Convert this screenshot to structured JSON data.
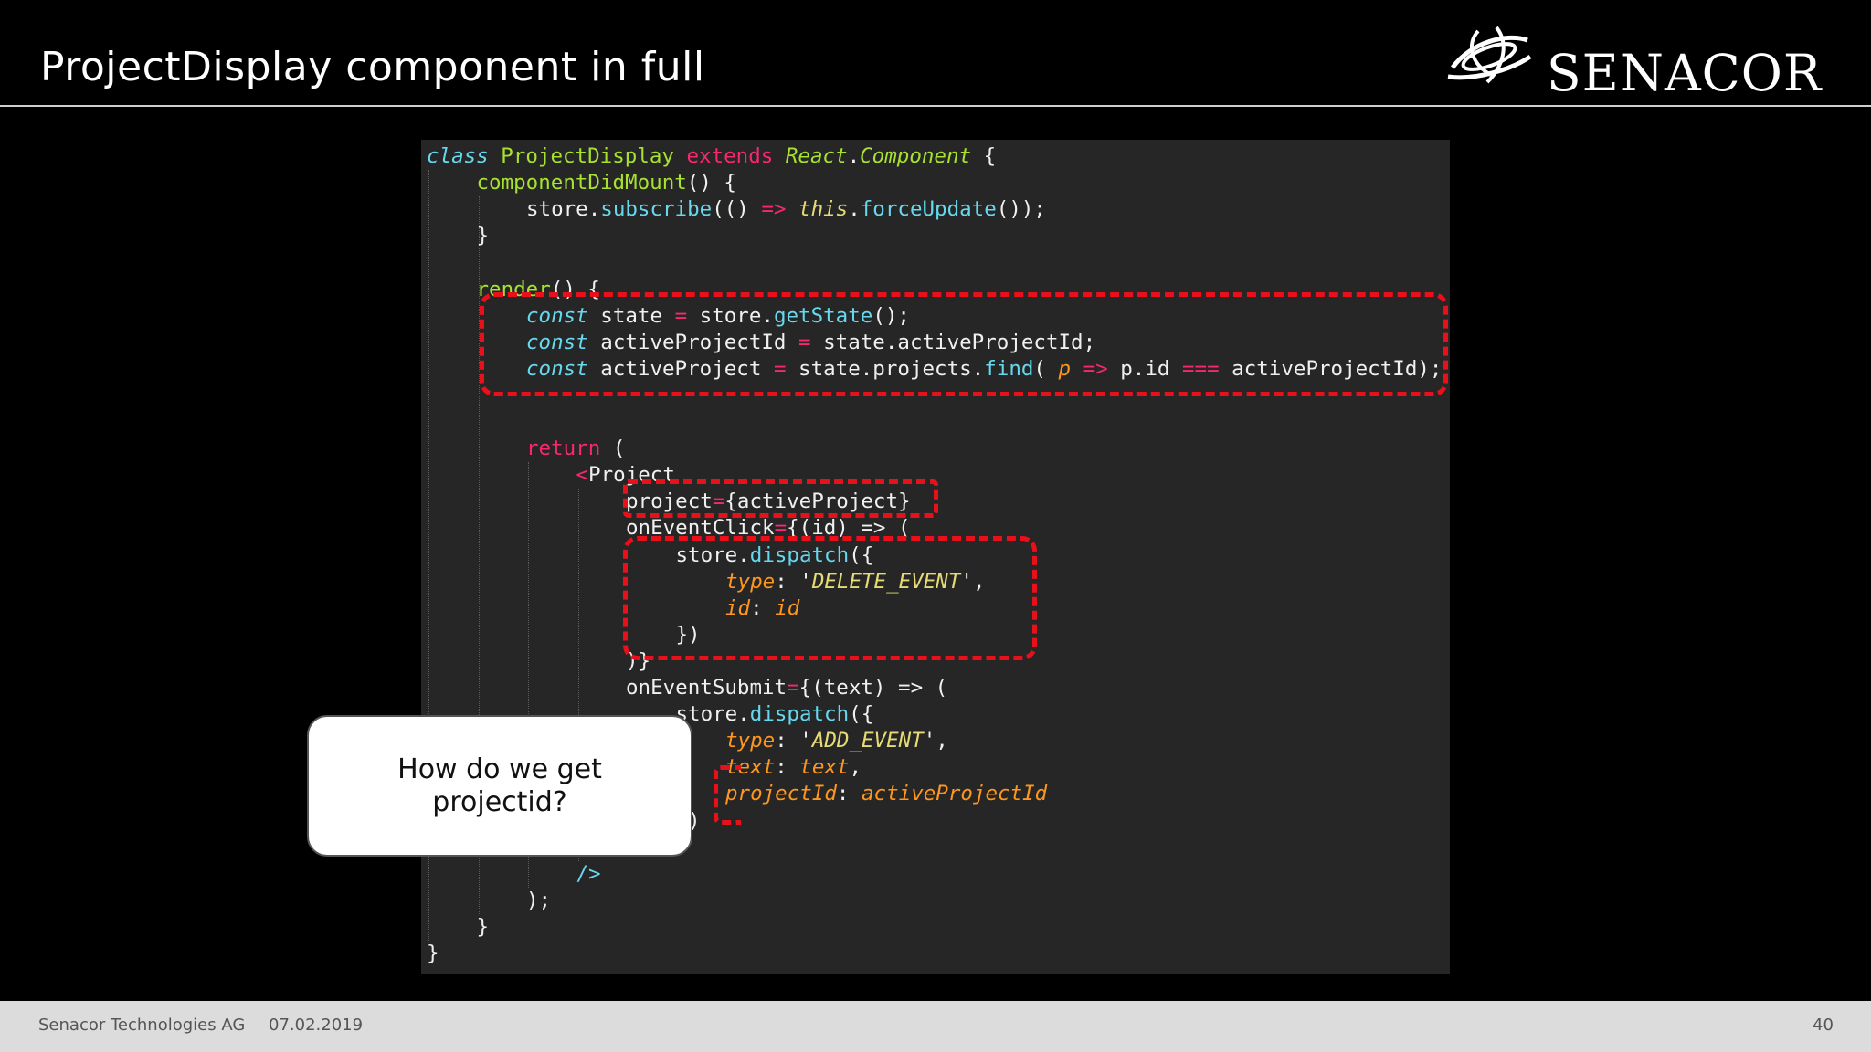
{
  "slide": {
    "title": "ProjectDisplay component in full",
    "logo_text": "SENACOR",
    "logo_icon": "senacor-swirl-logo"
  },
  "code_lines": [
    {
      "indent": 0,
      "tokens": [
        {
          "c": "kw-italic",
          "t": "class "
        },
        {
          "c": "cls",
          "t": "ProjectDisplay "
        },
        {
          "c": "kw-pink",
          "t": "extends "
        },
        {
          "c": "cls-it",
          "t": "React"
        },
        {
          "c": "plain",
          "t": "."
        },
        {
          "c": "cls-it",
          "t": "Component"
        },
        {
          "c": "plain",
          "t": " {"
        }
      ]
    },
    {
      "indent": 1,
      "tokens": [
        {
          "c": "meth",
          "t": "componentDidMount"
        },
        {
          "c": "plain",
          "t": "() {"
        }
      ]
    },
    {
      "indent": 2,
      "tokens": [
        {
          "c": "plain",
          "t": "store."
        },
        {
          "c": "fn",
          "t": "subscribe"
        },
        {
          "c": "plain",
          "t": "(() "
        },
        {
          "c": "kw-pink",
          "t": "=>"
        },
        {
          "c": "plain",
          "t": " "
        },
        {
          "c": "str",
          "t": "this"
        },
        {
          "c": "plain",
          "t": "."
        },
        {
          "c": "fn",
          "t": "forceUpdate"
        },
        {
          "c": "plain",
          "t": "());"
        }
      ]
    },
    {
      "indent": 1,
      "tokens": [
        {
          "c": "plain",
          "t": "}"
        }
      ]
    },
    {
      "indent": 1,
      "tokens": []
    },
    {
      "indent": 1,
      "tokens": [
        {
          "c": "meth",
          "t": "render"
        },
        {
          "c": "plain",
          "t": "() {"
        }
      ]
    },
    {
      "indent": 2,
      "tokens": [
        {
          "c": "kw-italic",
          "t": "const"
        },
        {
          "c": "plain",
          "t": " state "
        },
        {
          "c": "kw-pink",
          "t": "="
        },
        {
          "c": "plain",
          "t": " store."
        },
        {
          "c": "fn",
          "t": "getState"
        },
        {
          "c": "plain",
          "t": "();"
        }
      ]
    },
    {
      "indent": 2,
      "tokens": [
        {
          "c": "kw-italic",
          "t": "const"
        },
        {
          "c": "plain",
          "t": " activeProjectId "
        },
        {
          "c": "kw-pink",
          "t": "="
        },
        {
          "c": "plain",
          "t": " state.activeProjectId;"
        }
      ]
    },
    {
      "indent": 2,
      "tokens": [
        {
          "c": "kw-italic",
          "t": "const"
        },
        {
          "c": "plain",
          "t": " activeProject "
        },
        {
          "c": "kw-pink",
          "t": "="
        },
        {
          "c": "plain",
          "t": " state.projects."
        },
        {
          "c": "fn",
          "t": "find"
        },
        {
          "c": "plain",
          "t": "( "
        },
        {
          "c": "prop",
          "t": "p"
        },
        {
          "c": "plain",
          "t": " "
        },
        {
          "c": "kw-pink",
          "t": "=>"
        },
        {
          "c": "plain",
          "t": " p.id "
        },
        {
          "c": "kw-pink",
          "t": "==="
        },
        {
          "c": "plain",
          "t": " activeProjectId);"
        }
      ]
    },
    {
      "indent": 2,
      "tokens": []
    },
    {
      "indent": 2,
      "tokens": []
    },
    {
      "indent": 2,
      "tokens": [
        {
          "c": "kw-pink",
          "t": "return"
        },
        {
          "c": "plain",
          "t": " ("
        }
      ]
    },
    {
      "indent": 3,
      "tokens": [
        {
          "c": "kw-pink",
          "t": "<"
        },
        {
          "c": "plain",
          "t": "Project"
        }
      ]
    },
    {
      "indent": 4,
      "tokens": [
        {
          "c": "plain",
          "t": "project"
        },
        {
          "c": "kw-pink",
          "t": "="
        },
        {
          "c": "plain",
          "t": "{activeProject}"
        }
      ]
    },
    {
      "indent": 4,
      "tokens": [
        {
          "c": "plain",
          "t": "onEventClick"
        },
        {
          "c": "kw-pink",
          "t": "="
        },
        {
          "c": "plain",
          "t": "{(id) => ("
        }
      ]
    },
    {
      "indent": 5,
      "tokens": [
        {
          "c": "plain",
          "t": "store."
        },
        {
          "c": "fn",
          "t": "dispatch"
        },
        {
          "c": "plain",
          "t": "({"
        }
      ]
    },
    {
      "indent": 6,
      "tokens": [
        {
          "c": "prop",
          "t": "type"
        },
        {
          "c": "plain",
          "t": ": '"
        },
        {
          "c": "str",
          "t": "DELETE_EVENT"
        },
        {
          "c": "plain",
          "t": "',"
        }
      ]
    },
    {
      "indent": 6,
      "tokens": [
        {
          "c": "prop",
          "t": "id"
        },
        {
          "c": "plain",
          "t": ": "
        },
        {
          "c": "prop",
          "t": "id"
        }
      ]
    },
    {
      "indent": 5,
      "tokens": [
        {
          "c": "plain",
          "t": "})"
        }
      ]
    },
    {
      "indent": 4,
      "tokens": [
        {
          "c": "plain",
          "t": ")}"
        }
      ]
    },
    {
      "indent": 4,
      "tokens": [
        {
          "c": "plain",
          "t": "onEventSubmit"
        },
        {
          "c": "kw-pink",
          "t": "="
        },
        {
          "c": "plain",
          "t": "{(text) => ("
        }
      ]
    },
    {
      "indent": 5,
      "tokens": [
        {
          "c": "plain",
          "t": "store."
        },
        {
          "c": "fn",
          "t": "dispatch"
        },
        {
          "c": "plain",
          "t": "({"
        }
      ]
    },
    {
      "indent": 6,
      "tokens": [
        {
          "c": "prop",
          "t": "type"
        },
        {
          "c": "plain",
          "t": ": '"
        },
        {
          "c": "str",
          "t": "ADD_EVENT"
        },
        {
          "c": "plain",
          "t": "',"
        }
      ]
    },
    {
      "indent": 6,
      "tokens": [
        {
          "c": "prop",
          "t": "text"
        },
        {
          "c": "plain",
          "t": ": "
        },
        {
          "c": "prop",
          "t": "text"
        },
        {
          "c": "plain",
          "t": ","
        }
      ]
    },
    {
      "indent": 6,
      "tokens": [
        {
          "c": "prop",
          "t": "projectId"
        },
        {
          "c": "plain",
          "t": ": "
        },
        {
          "c": "prop",
          "t": "activeProjectId"
        }
      ]
    },
    {
      "indent": 5,
      "tokens": [
        {
          "c": "plain",
          "t": "})"
        }
      ]
    },
    {
      "indent": 4,
      "tokens": [
        {
          "c": "plain",
          "t": ")}"
        }
      ]
    },
    {
      "indent": 3,
      "tokens": [
        {
          "c": "fn",
          "t": "/>"
        }
      ]
    },
    {
      "indent": 2,
      "tokens": [
        {
          "c": "plain",
          "t": ");"
        }
      ]
    },
    {
      "indent": 1,
      "tokens": [
        {
          "c": "plain",
          "t": "}"
        }
      ]
    },
    {
      "indent": 0,
      "tokens": [
        {
          "c": "plain",
          "t": "}"
        }
      ]
    }
  ],
  "callout": {
    "text": "How do we get projectid?"
  },
  "footer": {
    "company": "Senacor Technologies AG",
    "date": "07.02.2019",
    "page_number": "40"
  },
  "colors": {
    "highlight_dash": "#e8101a",
    "code_background": "#262626",
    "footer_background": "#dcdcdc"
  }
}
